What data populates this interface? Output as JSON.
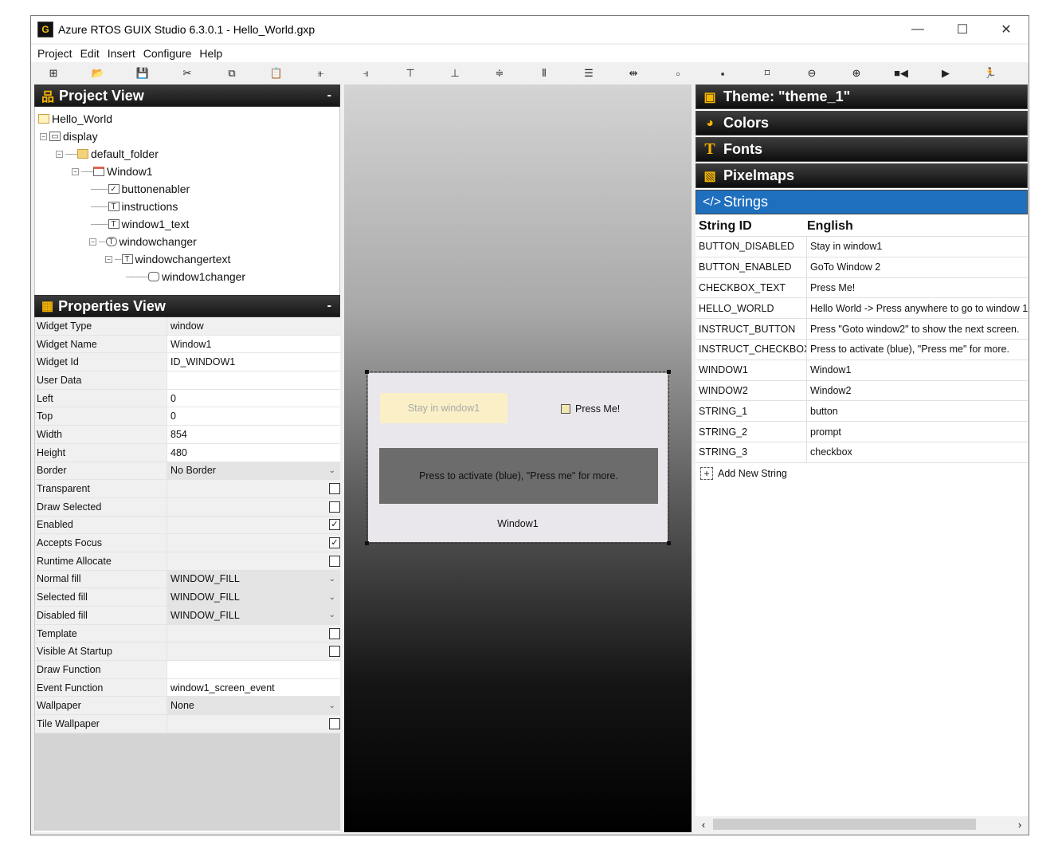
{
  "window": {
    "app_icon": "G",
    "title": "Azure RTOS GUIX Studio 6.3.0.1 - Hello_World.gxp",
    "controls": {
      "minimize": "—",
      "maximize": "☐",
      "close": "✕"
    }
  },
  "menu": [
    "Project",
    "Edit",
    "Insert",
    "Configure",
    "Help"
  ],
  "toolbar": [
    {
      "icon": "new-project-icon",
      "glyph": "⊞"
    },
    {
      "icon": "open-folder-icon",
      "glyph": "📂"
    },
    {
      "icon": "save-icon",
      "glyph": "💾"
    },
    {
      "icon": "cut-icon",
      "glyph": "✂"
    },
    {
      "icon": "copy-icon",
      "glyph": "⧉"
    },
    {
      "icon": "paste-icon",
      "glyph": "📋"
    },
    {
      "icon": "align-left-icon",
      "glyph": "⫦"
    },
    {
      "icon": "align-right-icon",
      "glyph": "⫣"
    },
    {
      "icon": "align-top-icon",
      "glyph": "⊤"
    },
    {
      "icon": "align-bottom-icon",
      "glyph": "⊥"
    },
    {
      "icon": "center-vertical-icon",
      "glyph": "≑"
    },
    {
      "icon": "space-horizontal-icon",
      "glyph": "⦀"
    },
    {
      "icon": "space-vertical-icon",
      "glyph": "☰"
    },
    {
      "icon": "equal-width-icon",
      "glyph": "⇹"
    },
    {
      "icon": "size-to-content-icon",
      "glyph": "▫"
    },
    {
      "icon": "move-back-icon",
      "glyph": "▪"
    },
    {
      "icon": "fit-content-icon",
      "glyph": "⌑"
    },
    {
      "icon": "zoom-out-icon",
      "glyph": "⊖"
    },
    {
      "icon": "zoom-in-icon",
      "glyph": "⊕"
    },
    {
      "icon": "record-macro-icon",
      "glyph": "■◀"
    },
    {
      "icon": "run-icon",
      "glyph": "▶"
    },
    {
      "icon": "run-app-icon",
      "glyph": "🏃"
    }
  ],
  "project_view": {
    "title": "Project View",
    "collapse": "-",
    "tree": [
      {
        "label": "Hello_World"
      },
      {
        "label": "display"
      },
      {
        "label": "default_folder"
      },
      {
        "label": "Window1"
      },
      {
        "label": "buttonenabler"
      },
      {
        "label": "instructions"
      },
      {
        "label": "window1_text"
      },
      {
        "label": "windowchanger"
      },
      {
        "label": "windowchangertext"
      },
      {
        "label": "window1changer"
      }
    ]
  },
  "properties_view": {
    "title": "Properties View",
    "collapse": "-",
    "rows": [
      {
        "label": "Widget Type",
        "value": "window"
      },
      {
        "label": "Widget Name",
        "value": "Window1"
      },
      {
        "label": "Widget Id",
        "value": "ID_WINDOW1"
      },
      {
        "label": "User Data",
        "value": ""
      },
      {
        "label": "Left",
        "value": "0"
      },
      {
        "label": "Top",
        "value": "0"
      },
      {
        "label": "Width",
        "value": "854"
      },
      {
        "label": "Height",
        "value": "480"
      },
      {
        "label": "Border",
        "value": "No Border"
      },
      {
        "label": "Transparent",
        "checked": false
      },
      {
        "label": "Draw Selected",
        "checked": false
      },
      {
        "label": "Enabled",
        "checked": true
      },
      {
        "label": "Accepts Focus",
        "checked": true
      },
      {
        "label": "Runtime Allocate",
        "checked": false
      },
      {
        "label": "Normal fill",
        "value": "WINDOW_FILL"
      },
      {
        "label": "Selected fill",
        "value": "WINDOW_FILL"
      },
      {
        "label": "Disabled fill",
        "value": "WINDOW_FILL"
      },
      {
        "label": "Template",
        "checked": false
      },
      {
        "label": "Visible At Startup",
        "checked": false
      },
      {
        "label": "Draw Function",
        "value": ""
      },
      {
        "label": "Event Function",
        "value": "window1_screen_event"
      },
      {
        "label": "Wallpaper",
        "value": "None"
      },
      {
        "label": "Tile Wallpaper",
        "checked": false
      }
    ]
  },
  "canvas": {
    "button_text": "Stay in window1",
    "checkbox_text": "Press Me!",
    "prompt_text": "Press to activate (blue), \"Press me\" for more.",
    "window_label": "Window1"
  },
  "resources": {
    "theme": "Theme: \"theme_1\"",
    "colors": "Colors",
    "fonts": "Fonts",
    "pixelmaps": "Pixelmaps",
    "strings": "Strings",
    "columns": [
      "String ID",
      "English"
    ],
    "string_rows": [
      {
        "id": "BUTTON_DISABLED",
        "english": "Stay in window1"
      },
      {
        "id": "BUTTON_ENABLED",
        "english": "GoTo Window 2"
      },
      {
        "id": "CHECKBOX_TEXT",
        "english": "Press Me!"
      },
      {
        "id": "HELLO_WORLD",
        "english": "Hello World -> Press anywhere to go to window 1"
      },
      {
        "id": "INSTRUCT_BUTTON",
        "english": "Press \"Goto window2\" to show the next screen."
      },
      {
        "id": "INSTRUCT_CHECKBOX",
        "english": "Press to activate (blue), \"Press me\" for more."
      },
      {
        "id": "WINDOW1",
        "english": "Window1"
      },
      {
        "id": "WINDOW2",
        "english": "Window2"
      },
      {
        "id": "STRING_1",
        "english": "button"
      },
      {
        "id": "STRING_2",
        "english": "prompt"
      },
      {
        "id": "STRING_3",
        "english": "checkbox"
      }
    ],
    "add_string": "Add New String"
  }
}
